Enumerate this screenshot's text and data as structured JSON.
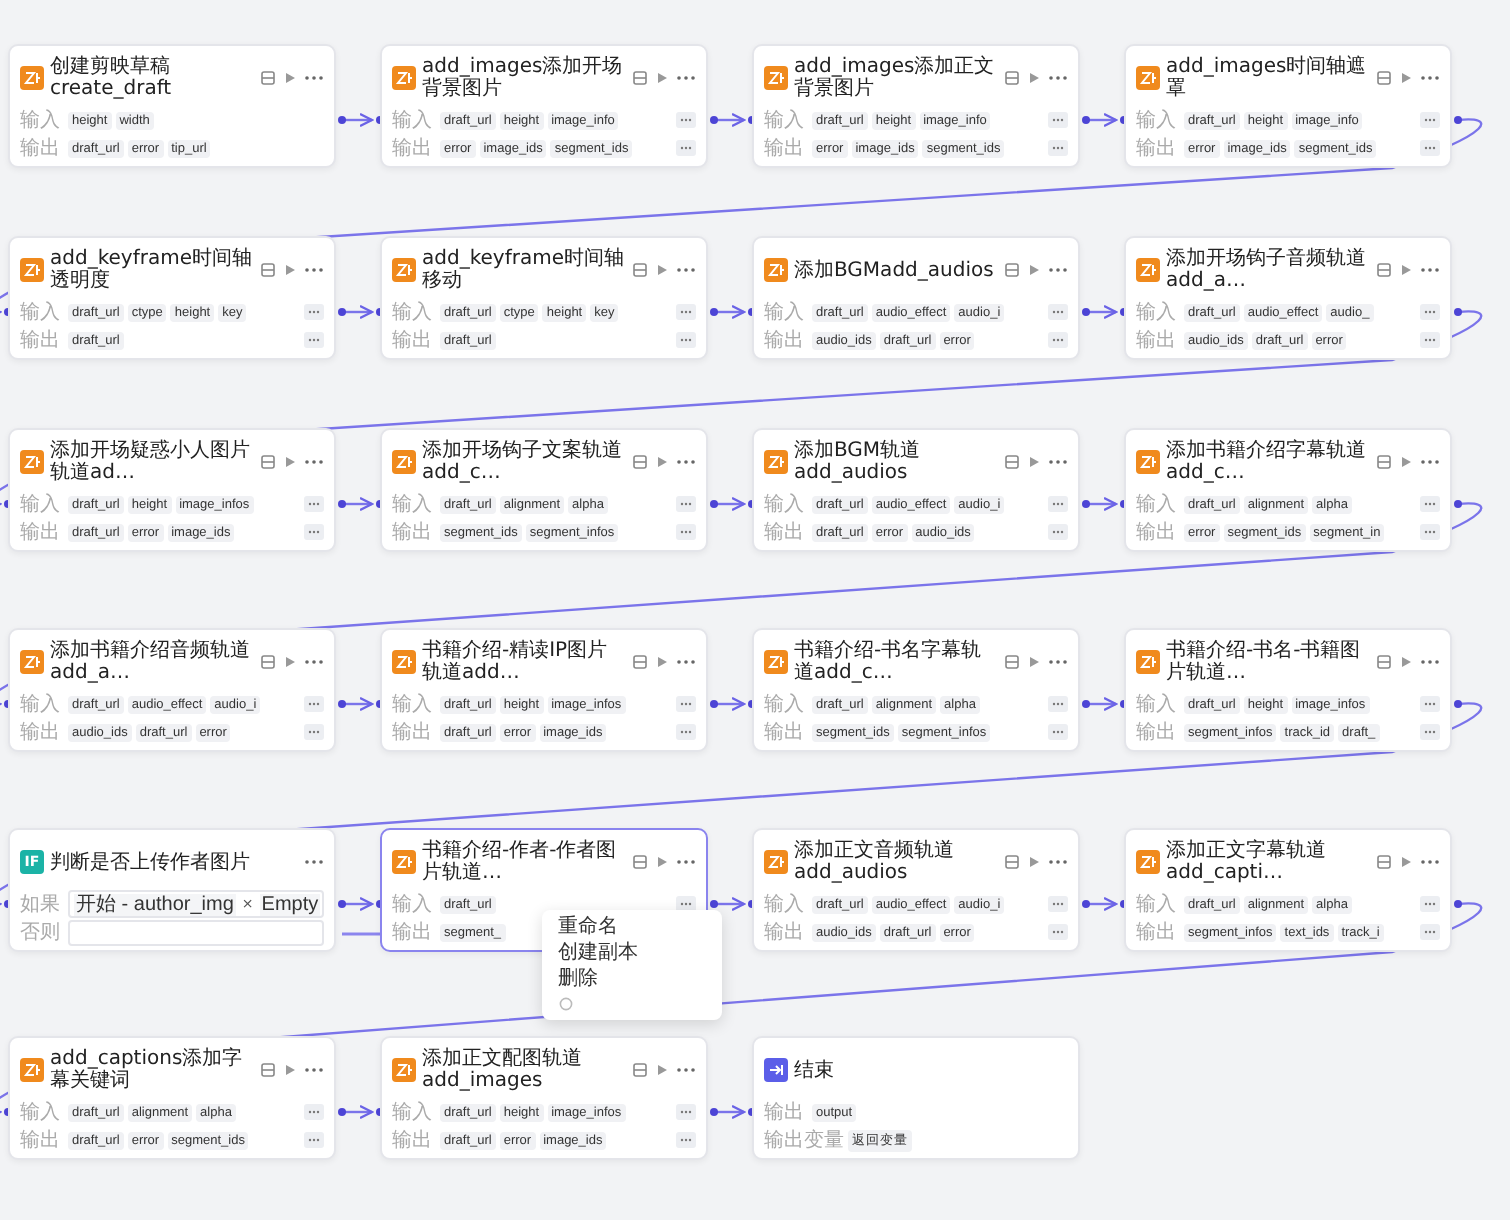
{
  "rows": [
    {
      "nodes": [
        {
          "kind": "plugin",
          "title": "创建剪映草稿create_draft",
          "selected": false,
          "more_fields": false,
          "inputs": {
            "label": "输入",
            "tags": [
              "height",
              "width"
            ]
          },
          "outputs": {
            "label": "输出",
            "tags": [
              "draft_url",
              "error",
              "tip_url"
            ]
          }
        },
        {
          "kind": "plugin",
          "title": "add_images添加开场背景图片",
          "selected": false,
          "more_fields": true,
          "inputs": {
            "label": "输入",
            "tags": [
              "draft_url",
              "height",
              "image_info"
            ]
          },
          "outputs": {
            "label": "输出",
            "tags": [
              "error",
              "image_ids",
              "segment_ids"
            ]
          }
        },
        {
          "kind": "plugin",
          "title": "add_images添加正文背景图片",
          "selected": false,
          "more_fields": true,
          "inputs": {
            "label": "输入",
            "tags": [
              "draft_url",
              "height",
              "image_info"
            ]
          },
          "outputs": {
            "label": "输出",
            "tags": [
              "error",
              "image_ids",
              "segment_ids"
            ]
          }
        },
        {
          "kind": "plugin",
          "title": "add_images时间轴遮罩",
          "selected": false,
          "more_fields": true,
          "inputs": {
            "label": "输入",
            "tags": [
              "draft_url",
              "height",
              "image_info"
            ]
          },
          "outputs": {
            "label": "输出",
            "tags": [
              "error",
              "image_ids",
              "segment_ids"
            ]
          }
        }
      ]
    },
    {
      "nodes": [
        {
          "kind": "plugin",
          "title": "add_keyframe时间轴透明度",
          "selected": false,
          "more_fields": true,
          "inputs": {
            "label": "输入",
            "tags": [
              "draft_url",
              "ctype",
              "height",
              "key"
            ]
          },
          "outputs": {
            "label": "输出",
            "tags": [
              "draft_url"
            ]
          }
        },
        {
          "kind": "plugin",
          "title": "add_keyframe时间轴移动",
          "selected": false,
          "more_fields": true,
          "inputs": {
            "label": "输入",
            "tags": [
              "draft_url",
              "ctype",
              "height",
              "key"
            ]
          },
          "outputs": {
            "label": "输出",
            "tags": [
              "draft_url"
            ]
          }
        },
        {
          "kind": "plugin",
          "title": "添加BGMadd_audios",
          "selected": false,
          "more_fields": true,
          "inputs": {
            "label": "输入",
            "tags": [
              "draft_url",
              "audio_effect",
              "audio_i"
            ]
          },
          "outputs": {
            "label": "输出",
            "tags": [
              "audio_ids",
              "draft_url",
              "error"
            ]
          }
        },
        {
          "kind": "plugin",
          "title": "添加开场钩子音频轨道add_a…",
          "selected": false,
          "more_fields": true,
          "inputs": {
            "label": "输入",
            "tags": [
              "draft_url",
              "audio_effect",
              "audio_"
            ]
          },
          "outputs": {
            "label": "输出",
            "tags": [
              "audio_ids",
              "draft_url",
              "error"
            ]
          }
        }
      ]
    },
    {
      "nodes": [
        {
          "kind": "plugin",
          "title": "添加开场疑惑小人图片轨道ad…",
          "selected": false,
          "more_fields": true,
          "inputs": {
            "label": "输入",
            "tags": [
              "draft_url",
              "height",
              "image_infos"
            ]
          },
          "outputs": {
            "label": "输出",
            "tags": [
              "draft_url",
              "error",
              "image_ids"
            ]
          }
        },
        {
          "kind": "plugin",
          "title": "添加开场钩子文案轨道add_c…",
          "selected": false,
          "more_fields": true,
          "inputs": {
            "label": "输入",
            "tags": [
              "draft_url",
              "alignment",
              "alpha"
            ]
          },
          "outputs": {
            "label": "输出",
            "tags": [
              "segment_ids",
              "segment_infos"
            ]
          }
        },
        {
          "kind": "plugin",
          "title": "添加BGM轨道add_audios",
          "selected": false,
          "more_fields": true,
          "inputs": {
            "label": "输入",
            "tags": [
              "draft_url",
              "audio_effect",
              "audio_i"
            ]
          },
          "outputs": {
            "label": "输出",
            "tags": [
              "draft_url",
              "error",
              "audio_ids"
            ]
          }
        },
        {
          "kind": "plugin",
          "title": "添加书籍介绍字幕轨道add_c…",
          "selected": false,
          "more_fields": true,
          "inputs": {
            "label": "输入",
            "tags": [
              "draft_url",
              "alignment",
              "alpha"
            ]
          },
          "outputs": {
            "label": "输出",
            "tags": [
              "error",
              "segment_ids",
              "segment_in"
            ]
          }
        }
      ]
    },
    {
      "nodes": [
        {
          "kind": "plugin",
          "title": "添加书籍介绍音频轨道add_a…",
          "selected": false,
          "more_fields": true,
          "inputs": {
            "label": "输入",
            "tags": [
              "draft_url",
              "audio_effect",
              "audio_i"
            ]
          },
          "outputs": {
            "label": "输出",
            "tags": [
              "audio_ids",
              "draft_url",
              "error"
            ]
          }
        },
        {
          "kind": "plugin",
          "title": "书籍介绍-精读IP图片轨道add…",
          "selected": false,
          "more_fields": true,
          "inputs": {
            "label": "输入",
            "tags": [
              "draft_url",
              "height",
              "image_infos"
            ]
          },
          "outputs": {
            "label": "输出",
            "tags": [
              "draft_url",
              "error",
              "image_ids"
            ]
          }
        },
        {
          "kind": "plugin",
          "title": "书籍介绍-书名字幕轨道add_c…",
          "selected": false,
          "more_fields": true,
          "inputs": {
            "label": "输入",
            "tags": [
              "draft_url",
              "alignment",
              "alpha"
            ]
          },
          "outputs": {
            "label": "输出",
            "tags": [
              "segment_ids",
              "segment_infos"
            ]
          }
        },
        {
          "kind": "plugin",
          "title": "书籍介绍-书名-书籍图片轨道…",
          "selected": false,
          "more_fields": true,
          "inputs": {
            "label": "输入",
            "tags": [
              "draft_url",
              "height",
              "image_infos"
            ]
          },
          "outputs": {
            "label": "输出",
            "tags": [
              "segment_infos",
              "track_id",
              "draft_"
            ]
          }
        }
      ]
    },
    {
      "nodes": [
        {
          "kind": "condition",
          "icon_text": "IF",
          "title": "判断是否上传作者图片",
          "selected": false,
          "if_label": "如果",
          "left": "开始 - author_img",
          "operator": "×",
          "right": "Empty",
          "else_label": "否则"
        },
        {
          "kind": "plugin",
          "title": "书籍介绍-作者-作者图片轨道…",
          "selected": true,
          "more_fields": true,
          "inputs": {
            "label": "输入",
            "tags": [
              "draft_url"
            ]
          },
          "outputs": {
            "label": "输出",
            "tags": [
              "segment_"
            ]
          },
          "menu": [
            "重命名",
            "创建副本",
            "删除"
          ]
        },
        {
          "kind": "plugin",
          "title": "添加正文音频轨道add_audios",
          "selected": false,
          "more_fields": true,
          "inputs": {
            "label": "输入",
            "tags": [
              "draft_url",
              "audio_effect",
              "audio_i"
            ]
          },
          "outputs": {
            "label": "输出",
            "tags": [
              "audio_ids",
              "draft_url",
              "error"
            ]
          }
        },
        {
          "kind": "plugin",
          "title": "添加正文字幕轨道add_capti…",
          "selected": false,
          "more_fields": true,
          "inputs": {
            "label": "输入",
            "tags": [
              "draft_url",
              "alignment",
              "alpha"
            ]
          },
          "outputs": {
            "label": "输出",
            "tags": [
              "segment_infos",
              "text_ids",
              "track_i"
            ]
          }
        }
      ]
    },
    {
      "nodes": [
        {
          "kind": "plugin",
          "title": "add_captions添加字幕关键词",
          "selected": false,
          "more_fields": true,
          "inputs": {
            "label": "输入",
            "tags": [
              "draft_url",
              "alignment",
              "alpha"
            ]
          },
          "outputs": {
            "label": "输出",
            "tags": [
              "draft_url",
              "error",
              "segment_ids"
            ]
          }
        },
        {
          "kind": "plugin",
          "title": "添加正文配图轨道add_images",
          "selected": false,
          "more_fields": true,
          "inputs": {
            "label": "输入",
            "tags": [
              "draft_url",
              "height",
              "image_infos"
            ]
          },
          "outputs": {
            "label": "输出",
            "tags": [
              "draft_url",
              "error",
              "image_ids"
            ]
          }
        },
        {
          "kind": "end",
          "title": "结束",
          "selected": false,
          "fields": [
            {
              "label": "输出",
              "value": "output"
            },
            {
              "label": "输出变量",
              "value": "返回变量"
            }
          ]
        }
      ]
    }
  ]
}
